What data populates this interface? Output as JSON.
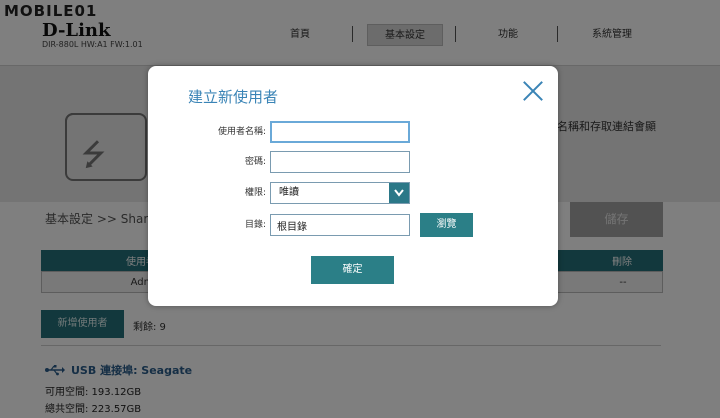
{
  "watermark": "MOBILE01",
  "header": {
    "brand": "D-Link",
    "model_info": "DIR-880L   HW:A1   FW:1.01",
    "nav": [
      {
        "label": "首頁"
      },
      {
        "label": "基本設定",
        "active": true
      },
      {
        "label": "功能"
      },
      {
        "label": "系統管理"
      }
    ]
  },
  "hero": {
    "text": "名稱和存取連結會顯"
  },
  "breadcrumb": "基本設定 >> Share",
  "save_label": "儲存",
  "table": {
    "headers": [
      "使用者",
      "刪除"
    ],
    "rows": [
      {
        "user": "Adm",
        "delete": "--"
      }
    ]
  },
  "add_user_label": "新增使用者",
  "remaining": "剩餘: 9",
  "usb": {
    "label": "USB 連接埠: Seagate",
    "available": "可用空間: 193.12GB",
    "total": "總共空間: 223.57GB"
  },
  "modal": {
    "title": "建立新使用者",
    "username_label": "使用者名稱:",
    "username_value": "",
    "password_label": "密碼:",
    "password_value": "",
    "permission_label": "權限:",
    "permission_value": "唯讀",
    "directory_label": "目錄:",
    "directory_value": "根目錄",
    "browse_label": "瀏覽",
    "ok_label": "確定"
  },
  "colors": {
    "teal": "#2b7f87",
    "header_teal": "#24707a",
    "title_blue": "#3a84b6"
  }
}
